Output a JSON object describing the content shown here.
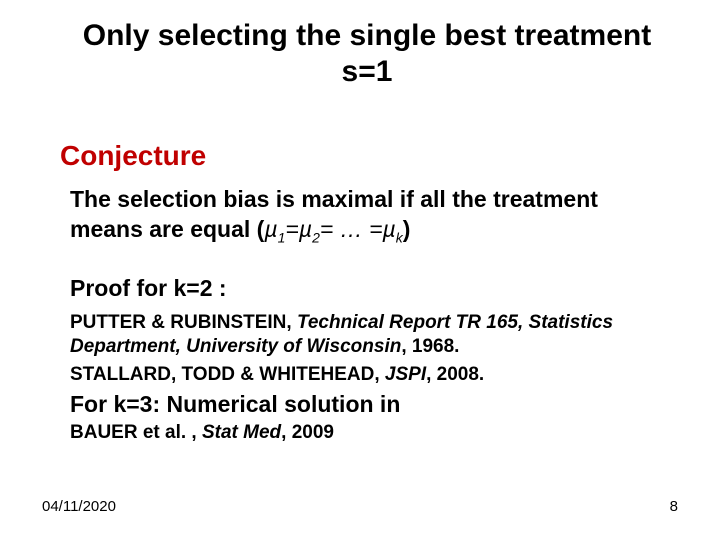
{
  "title_line1": "Only selecting the single best treatment",
  "title_line2": "s=1",
  "conjecture_heading": "Conjecture",
  "statement_lead": "The selection bias is maximal if all the treatment means are equal (",
  "mu1": "µ",
  "sub1": "1",
  "eq": "=",
  "mu2": "µ",
  "sub2": "2",
  "dots": "= … =",
  "muk": "µ",
  "subk": "k",
  "statement_tail": ")",
  "proof_heading": "Proof for k=2 :",
  "ref1_a": "PUTTER & RUBINSTEIN, ",
  "ref1_i": "Technical Report TR 165, Statistics Department, University of Wisconsin",
  "ref1_b": ", 1968.",
  "ref2_a": "STALLARD, TODD & WHITEHEAD, ",
  "ref2_i": "JSPI",
  "ref2_b": ", 2008.",
  "for_k3": "For k=3: Numerical solution in",
  "ref3_a": "BAUER et al. , ",
  "ref3_i": "Stat Med",
  "ref3_b": ", 2009",
  "date": "04/11/2020",
  "pagenum": "8"
}
